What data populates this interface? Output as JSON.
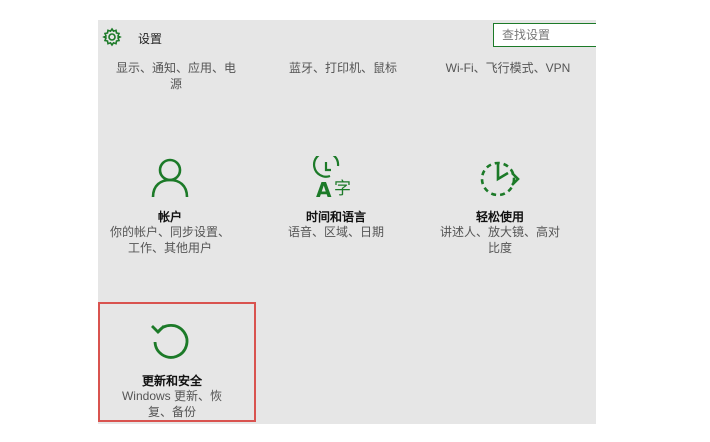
{
  "header": {
    "title": "设置",
    "search_placeholder": "查找设置"
  },
  "top_row": [
    {
      "desc_line1": "显示、通知、应用、电",
      "desc_line2": "源"
    },
    {
      "desc_line1": "蓝牙、打印机、鼠标"
    },
    {
      "desc_line1": "Wi-Fi、飞行模式、VPN"
    }
  ],
  "tiles": [
    {
      "name": "帐户",
      "desc_line1": "你的帐户、同步设置、",
      "desc_line2": "工作、其他用户",
      "icon": "person-icon"
    },
    {
      "name": "时间和语言",
      "desc_line1": "语音、区域、日期",
      "icon": "time-language-icon"
    },
    {
      "name": "轻松使用",
      "desc_line1": "讲述人、放大镜、高对",
      "desc_line2": "比度",
      "icon": "ease-of-access-icon"
    },
    {
      "name": "更新和安全",
      "desc_line1": "Windows 更新、恢",
      "desc_line2": "复、备份",
      "icon": "update-refresh-icon"
    }
  ],
  "colors": {
    "accent": "#1c7a28",
    "highlight_border": "#d9534f",
    "panel_bg": "#e6e6e6"
  }
}
